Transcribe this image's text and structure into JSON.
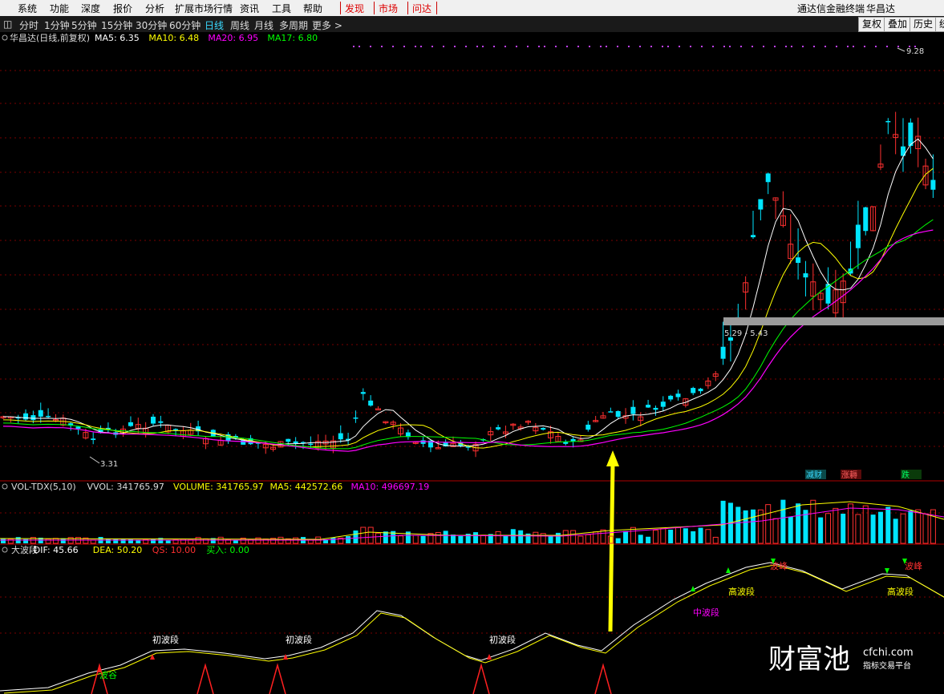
{
  "menubar": {
    "items": [
      "系统",
      "功能",
      "深度",
      "报价",
      "分析",
      "扩展市场行情",
      "资讯",
      "工具",
      "帮助"
    ],
    "highlight_items": [
      "发现",
      "市场",
      "问达"
    ],
    "app_title": "通达信金融终端",
    "stock_name": "华昌达"
  },
  "periodbar": {
    "items": [
      "分时",
      "1分钟",
      "5分钟",
      "15分钟",
      "30分钟",
      "60分钟",
      "日线",
      "周线",
      "月线",
      "多周期",
      "更多 >"
    ],
    "active": "日线",
    "right_buttons": [
      "复权",
      "叠加",
      "历史",
      "统"
    ]
  },
  "main_panel": {
    "title": "华昌达(日线,前复权)",
    "ma_labels": [
      {
        "text": "MA5: 6.35",
        "color": "#ffffff"
      },
      {
        "text": "MA10: 6.48",
        "color": "#ffff00"
      },
      {
        "text": "MA20: 6.95",
        "color": "#ff00ff"
      },
      {
        "text": "MA17: 6.80",
        "color": "#00ff00"
      }
    ],
    "price_high": "9.28",
    "price_low": "3.31",
    "zone_label": "5.29 - 5.43"
  },
  "volume_panel": {
    "labels": [
      {
        "text": "VOL-TDX(5,10)",
        "color": "#dddddd"
      },
      {
        "text": "VVOL: 341765.97",
        "color": "#dddddd"
      },
      {
        "text": "VOLUME: 341765.97",
        "color": "#ffff00"
      },
      {
        "text": "MA5: 442572.66",
        "color": "#ffff00"
      },
      {
        "text": "MA10: 496697.19",
        "color": "#ff00ff"
      }
    ],
    "tags": [
      {
        "text": "减财",
        "color": "#3ad9ff"
      },
      {
        "text": "涨耨",
        "color": "#ff6060"
      },
      {
        "text": "跌",
        "color": "#00ff66"
      }
    ]
  },
  "indicator_panel": {
    "labels": [
      {
        "text": "大波段",
        "color": "#dddddd"
      },
      {
        "text": "DIF: 45.66",
        "color": "#ffffff"
      },
      {
        "text": "DEA: 50.20",
        "color": "#ffff00"
      },
      {
        "text": "QS: 10.00",
        "color": "#ff3030"
      },
      {
        "text": "买入: 0.00",
        "color": "#00ff00"
      }
    ],
    "annotations": [
      {
        "text": "波谷",
        "color": "#00ff00"
      },
      {
        "text": "初波段",
        "color": "#ffffff"
      },
      {
        "text": "初波段",
        "color": "#ffffff"
      },
      {
        "text": "初波段",
        "color": "#ffffff"
      },
      {
        "text": "中波段",
        "color": "#ff00ff"
      },
      {
        "text": "高波段",
        "color": "#ffff00"
      },
      {
        "text": "高波段",
        "color": "#ffff00"
      },
      {
        "text": "波峰",
        "color": "#ff3030"
      },
      {
        "text": "波峰",
        "color": "#ff3030"
      }
    ]
  },
  "watermark": {
    "brand": "财富池",
    "domain": "cfchi.com",
    "slogan": "指标交易平台"
  },
  "colors": {
    "up": "#ff3030",
    "down": "#00e5ff",
    "grid": "#7a0000"
  }
}
